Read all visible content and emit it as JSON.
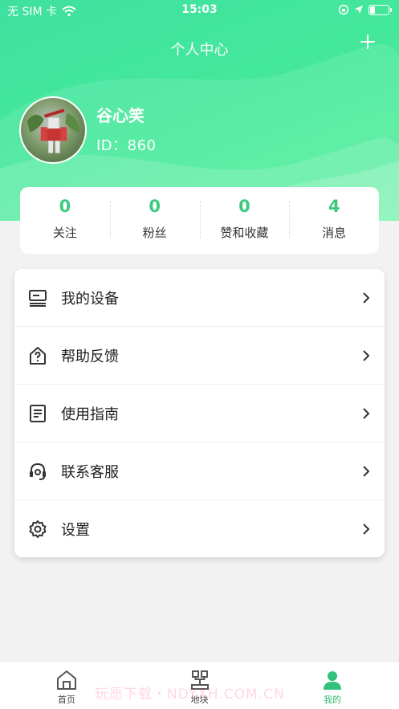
{
  "status_bar": {
    "carrier": "无 SIM 卡",
    "time": "15:03",
    "battery_level": 0.3
  },
  "header": {
    "title": "个人中心",
    "add_icon": "plus-icon"
  },
  "profile": {
    "name": "谷心笑",
    "id_text": "ID：860"
  },
  "stats": [
    {
      "value": "0",
      "label": "关注"
    },
    {
      "value": "0",
      "label": "粉丝"
    },
    {
      "value": "0",
      "label": "赞和收藏"
    },
    {
      "value": "4",
      "label": "消息"
    }
  ],
  "menu": [
    {
      "label": "我的设备",
      "icon": "device-icon"
    },
    {
      "label": "帮助反馈",
      "icon": "help-icon"
    },
    {
      "label": "使用指南",
      "icon": "guide-icon"
    },
    {
      "label": "联系客服",
      "icon": "customer-service-icon"
    },
    {
      "label": "设置",
      "icon": "settings-icon"
    }
  ],
  "tabbar": [
    {
      "label": "首页",
      "icon": "home-icon",
      "active": false
    },
    {
      "label": "地块",
      "icon": "plot-icon",
      "active": false
    },
    {
      "label": "我的",
      "icon": "user-icon",
      "active": true
    }
  ],
  "watermark": "玩愿下载・NDYXH.COM.CN",
  "colors": {
    "accent": "#3cc97f",
    "hero_start": "#3fe0a0",
    "hero_end": "#55f09a"
  }
}
